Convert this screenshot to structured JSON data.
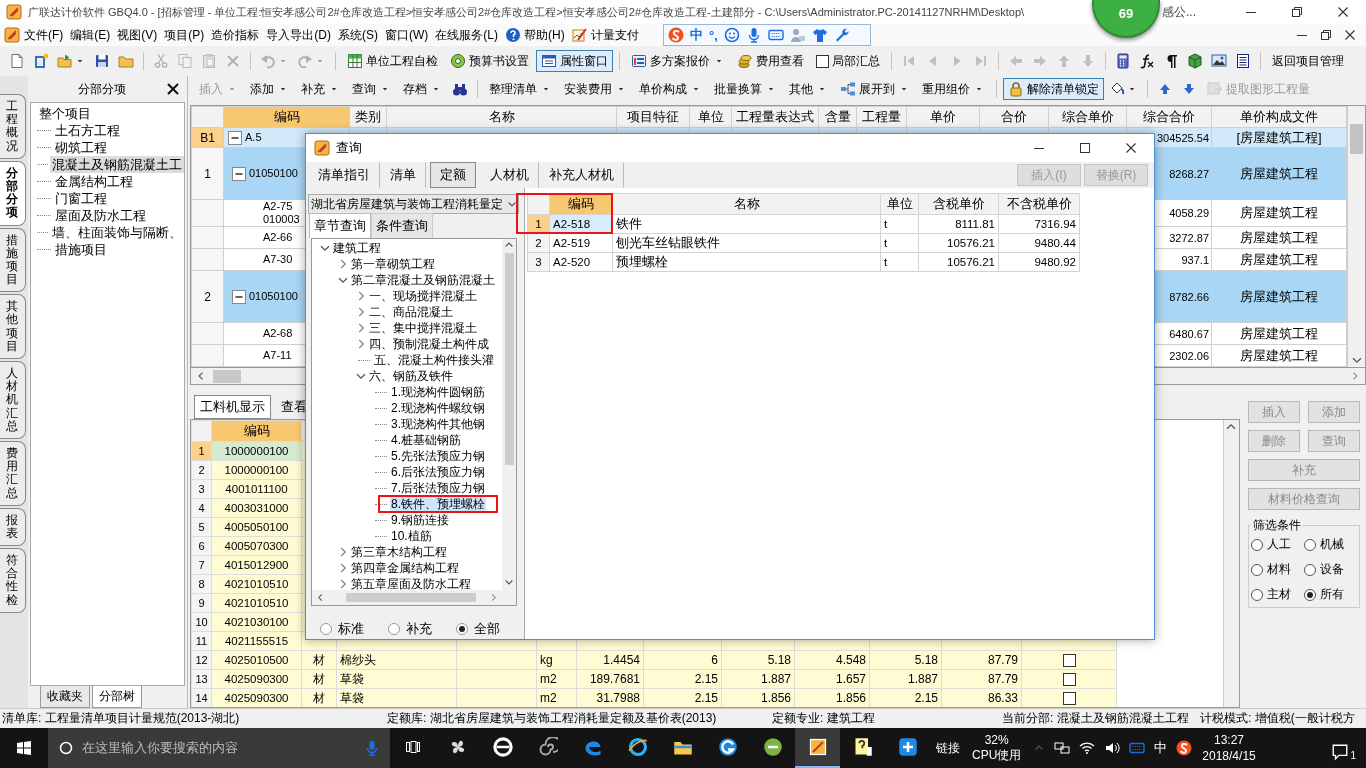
{
  "title_bar": {
    "title": "广联达计价软件 GBQ4.0 - [招标管理 - 单位工程:恒安孝感公司2#仓库改造工程>恒安孝感公司2#仓库改造工程>恒安孝感公司2#仓库改造工程-土建部分 - C:\\Users\\Administrator.PC-20141127NRHM\\Desktop\\",
    "badge": "69",
    "title_tail": "感公..."
  },
  "menu": [
    "文件(F)",
    "编辑(E)",
    "视图(V)",
    "项目(P)",
    "造价指标",
    "导入导出(D)",
    "系统(S)",
    "窗口(W)",
    "在线服务(L)",
    "帮助(H)",
    "计量支付"
  ],
  "ime_bar": {
    "labels": [
      "中",
      "°,"
    ]
  },
  "toolbar": [
    {
      "kind": "icon",
      "disabled": false,
      "pressed": false,
      "dropdown": false
    },
    {
      "kind": "icon",
      "disabled": false,
      "pressed": false,
      "dropdown": false
    },
    {
      "kind": "icon",
      "disabled": false,
      "pressed": false,
      "dropdown": true
    },
    {
      "kind": "icon",
      "disabled": false,
      "pressed": false,
      "dropdown": false
    },
    {
      "kind": "icon",
      "disabled": false,
      "pressed": false,
      "dropdown": false
    },
    {
      "kind": "sep"
    },
    {
      "kind": "icon",
      "disabled": true,
      "pressed": false,
      "dropdown": false
    },
    {
      "kind": "icon",
      "disabled": true,
      "pressed": false,
      "dropdown": false
    },
    {
      "kind": "icon",
      "disabled": true,
      "pressed": false,
      "dropdown": false
    },
    {
      "kind": "icon",
      "disabled": true,
      "pressed": false,
      "dropdown": false
    },
    {
      "kind": "sep"
    },
    {
      "kind": "icon",
      "disabled": true,
      "pressed": false,
      "dropdown": true
    },
    {
      "kind": "icon",
      "disabled": true,
      "pressed": false,
      "dropdown": true
    },
    {
      "kind": "sep"
    },
    {
      "kind": "button",
      "label": "单位工程自检",
      "disabled": false,
      "pressed": false,
      "dropdown": false
    },
    {
      "kind": "button",
      "label": "预算书设置",
      "disabled": false,
      "pressed": false,
      "dropdown": false
    },
    {
      "kind": "button",
      "label": "属性窗口",
      "disabled": false,
      "pressed": true,
      "dropdown": false
    },
    {
      "kind": "sep"
    },
    {
      "kind": "button",
      "label": "多方案报价",
      "disabled": false,
      "pressed": false,
      "dropdown": true
    },
    {
      "kind": "button",
      "label": "费用查看",
      "disabled": false,
      "pressed": false,
      "dropdown": false
    },
    {
      "kind": "check",
      "label": "局部汇总",
      "checked": false
    },
    {
      "kind": "sep"
    },
    {
      "kind": "icon",
      "disabled": true,
      "pressed": false,
      "dropdown": false
    },
    {
      "kind": "icon",
      "disabled": true,
      "pressed": false,
      "dropdown": false
    },
    {
      "kind": "icon",
      "disabled": true,
      "pressed": false,
      "dropdown": false
    },
    {
      "kind": "icon",
      "disabled": true,
      "pressed": false,
      "dropdown": false
    },
    {
      "kind": "sep"
    },
    {
      "kind": "icon",
      "disabled": true,
      "pressed": false,
      "dropdown": false
    },
    {
      "kind": "icon",
      "disabled": true,
      "pressed": false,
      "dropdown": false
    },
    {
      "kind": "icon",
      "disabled": true,
      "pressed": false,
      "dropdown": false
    },
    {
      "kind": "icon",
      "disabled": true,
      "pressed": false,
      "dropdown": false
    },
    {
      "kind": "sep"
    },
    {
      "kind": "icon",
      "disabled": false,
      "pressed": false,
      "dropdown": false
    },
    {
      "kind": "icon",
      "disabled": false,
      "pressed": false,
      "dropdown": false
    },
    {
      "kind": "icon",
      "disabled": false,
      "pressed": false,
      "dropdown": false
    },
    {
      "kind": "icon",
      "disabled": false,
      "pressed": false,
      "dropdown": false
    },
    {
      "kind": "icon",
      "disabled": false,
      "pressed": false,
      "dropdown": false
    },
    {
      "kind": "icon",
      "disabled": false,
      "pressed": false,
      "dropdown": false
    },
    {
      "kind": "sep"
    },
    {
      "kind": "button",
      "label": "返回项目管理",
      "disabled": false,
      "pressed": false,
      "dropdown": false
    }
  ],
  "side_tabs": [
    {
      "label": "工程概况",
      "selected": false
    },
    {
      "label": "分部分项",
      "selected": true
    },
    {
      "label": "措施项目",
      "selected": false
    },
    {
      "label": "其他项目",
      "selected": false
    },
    {
      "label": "人材机汇总",
      "selected": false
    },
    {
      "label": "费用汇总",
      "selected": false
    },
    {
      "label": "报表",
      "selected": false
    },
    {
      "label": "符合性检",
      "selected": false
    }
  ],
  "left_panel": {
    "title": "分部分项",
    "tree": [
      {
        "label": "整个项目",
        "selected": false,
        "children": [
          {
            "label": "土石方工程",
            "selected": false
          },
          {
            "label": "砌筑工程",
            "selected": false
          },
          {
            "label": "混凝土及钢筋混凝土工",
            "selected": true
          },
          {
            "label": "金属结构工程",
            "selected": false
          },
          {
            "label": "门窗工程",
            "selected": false
          },
          {
            "label": "屋面及防水工程",
            "selected": false
          },
          {
            "label": "墙、柱面装饰与隔断、",
            "selected": false
          },
          {
            "label": "措施项目",
            "selected": false
          }
        ]
      }
    ],
    "tabs": [
      {
        "label": "收藏夹",
        "selected": false
      },
      {
        "label": "分部树",
        "selected": true
      }
    ]
  },
  "toolbar2": [
    {
      "kind": "button",
      "label": "插入",
      "disabled": true,
      "pressed": false,
      "dropdown": true
    },
    {
      "kind": "button",
      "label": "添加",
      "disabled": false,
      "pressed": false,
      "dropdown": true
    },
    {
      "kind": "button",
      "label": "补充",
      "disabled": false,
      "pressed": false,
      "dropdown": true
    },
    {
      "kind": "button",
      "label": "查询",
      "disabled": false,
      "pressed": false,
      "dropdown": true
    },
    {
      "kind": "button",
      "label": "存档",
      "disabled": false,
      "pressed": false,
      "dropdown": true
    },
    {
      "kind": "icon",
      "disabled": false,
      "pressed": false,
      "dropdown": false
    },
    {
      "kind": "sep"
    },
    {
      "kind": "button",
      "label": "整理清单",
      "disabled": false,
      "pressed": false,
      "dropdown": true
    },
    {
      "kind": "button",
      "label": "安装费用",
      "disabled": false,
      "pressed": false,
      "dropdown": true
    },
    {
      "kind": "button",
      "label": "单价构成",
      "disabled": false,
      "pressed": false,
      "dropdown": true
    },
    {
      "kind": "button",
      "label": "批量换算",
      "disabled": false,
      "pressed": false,
      "dropdown": true
    },
    {
      "kind": "button",
      "label": "其他",
      "disabled": false,
      "pressed": false,
      "dropdown": true
    },
    {
      "kind": "button",
      "label": "展开到",
      "disabled": false,
      "pressed": false,
      "dropdown": true
    },
    {
      "kind": "button",
      "label": "重用组价",
      "disabled": false,
      "pressed": false,
      "dropdown": true
    },
    {
      "kind": "sep"
    },
    {
      "kind": "button",
      "label": "解除清单锁定",
      "disabled": false,
      "pressed": true,
      "dropdown": false
    },
    {
      "kind": "icon",
      "disabled": false,
      "pressed": false,
      "dropdown": true
    },
    {
      "kind": "sep"
    },
    {
      "kind": "icon",
      "disabled": false,
      "pressed": false,
      "dropdown": false
    },
    {
      "kind": "icon",
      "disabled": false,
      "pressed": false,
      "dropdown": false
    },
    {
      "kind": "button",
      "label": "提取图形工程量",
      "disabled": true,
      "pressed": false,
      "dropdown": false
    }
  ],
  "main_grid": {
    "columns": [
      {
        "label": "编码",
        "selected": true
      },
      {
        "label": "类别",
        "selected": false
      },
      {
        "label": "名称",
        "selected": false
      },
      {
        "label": "项目特征",
        "selected": false
      },
      {
        "label": "单位",
        "selected": false
      },
      {
        "label": "工程量表达式",
        "selected": false
      },
      {
        "label": "含量",
        "selected": false
      },
      {
        "label": "工程量",
        "selected": false
      },
      {
        "label": "单价",
        "selected": false
      },
      {
        "label": "合价",
        "selected": false
      },
      {
        "label": "综合单价",
        "selected": false
      },
      {
        "label": "综合合价",
        "selected": false
      },
      {
        "label": "单价构成文件",
        "selected": false
      }
    ],
    "rows": [
      {
        "kind": "section",
        "num": "B1",
        "code": "A.5",
        "total": "304525.54",
        "file": "[房屋建筑工程]",
        "selected": true
      },
      {
        "kind": "item",
        "num": "1",
        "code": "01050100",
        "total": "8268.27",
        "file": "房屋建筑工程",
        "selected": false
      },
      {
        "kind": "sub",
        "code": "A2-75\n010003",
        "total": "4058.29",
        "file": "房屋建筑工程",
        "selected": false
      },
      {
        "kind": "sub",
        "code": "A2-66",
        "total": "3272.87",
        "file": "房屋建筑工程",
        "selected": false
      },
      {
        "kind": "sub",
        "code": "A7-30",
        "total": "937.1",
        "file": "房屋建筑工程",
        "selected": false
      },
      {
        "kind": "item",
        "num": "2",
        "code": "01050100",
        "total": "8782.66",
        "file": "房屋建筑工程",
        "selected": false
      },
      {
        "kind": "sub",
        "code": "A2-68",
        "total": "6480.67",
        "file": "房屋建筑工程",
        "selected": false
      },
      {
        "kind": "sub",
        "code": "A7-11",
        "total": "2302.06",
        "file": "房屋建筑工程",
        "selected": false
      }
    ]
  },
  "bottom": {
    "tabs": [
      {
        "label": "工料机显示",
        "selected": true
      },
      {
        "label": "查看",
        "selected": false
      }
    ],
    "grid": {
      "columns": [
        {
          "label": "编码",
          "selected": true
        }
      ],
      "rows": [
        {
          "num": "1",
          "code": "1000000100",
          "selected": true
        },
        {
          "num": "2",
          "code": "1000000100",
          "selected": false
        },
        {
          "num": "3",
          "code": "4001011100",
          "selected": false
        },
        {
          "num": "4",
          "code": "4003031000",
          "selected": false
        },
        {
          "num": "5",
          "code": "4005050100",
          "selected": false
        },
        {
          "num": "6",
          "code": "4005070300",
          "selected": false
        },
        {
          "num": "7",
          "code": "4015012900",
          "selected": false
        },
        {
          "num": "8",
          "code": "4021010510",
          "selected": false
        },
        {
          "num": "9",
          "code": "4021010510",
          "selected": false
        },
        {
          "num": "10",
          "code": "4021030100",
          "selected": false
        },
        {
          "num": "11",
          "code": "4021155515",
          "selected": false
        },
        {
          "num": "12",
          "code": "4025010500",
          "selected": false,
          "column_3": "材",
          "column_4": "棉纱头",
          "column_6": "kg",
          "column_7": "1.4454",
          "column_8": "6",
          "column_9": "5.18",
          "column_10": "4.548",
          "column_11": "5.18",
          "column_12": "87.79",
          "checked": false
        },
        {
          "num": "13",
          "code": "4025090300",
          "selected": false,
          "column_3": "材",
          "column_4": "草袋",
          "column_6": "m2",
          "column_7": "189.7681",
          "column_8": "2.15",
          "column_9": "1.887",
          "column_10": "1.657",
          "column_11": "1.887",
          "column_12": "87.79",
          "checked": false
        },
        {
          "num": "14",
          "code": "4025090300",
          "selected": false,
          "column_3": "材",
          "column_4": "草袋",
          "column_6": "m2",
          "column_7": "31.7988",
          "column_8": "2.15",
          "column_9": "1.856",
          "column_10": "1.856",
          "column_11": "2.15",
          "column_12": "86.33",
          "checked": false
        }
      ]
    },
    "buttons": [
      {
        "label": "插入",
        "disabled": true
      },
      {
        "label": "添加",
        "disabled": true
      },
      {
        "label": "删除",
        "disabled": true
      },
      {
        "label": "查询",
        "disabled": true
      },
      {
        "label": "补充",
        "disabled": true
      },
      {
        "label": "材料价格查询",
        "disabled": true
      }
    ],
    "filter": {
      "title": "筛选条件",
      "options": [
        {
          "label": "人工",
          "selected": false
        },
        {
          "label": "机械",
          "selected": false
        },
        {
          "label": "材料",
          "selected": false
        },
        {
          "label": "设备",
          "selected": false
        },
        {
          "label": "主材",
          "selected": false
        },
        {
          "label": "所有",
          "selected": true
        }
      ]
    }
  },
  "dialog": {
    "title": "查询",
    "tabs": [
      {
        "label": "清单指引",
        "selected": false
      },
      {
        "label": "清单",
        "selected": false
      },
      {
        "label": "定额",
        "selected": true
      },
      {
        "label": "人材机",
        "selected": false
      },
      {
        "label": "补充人材机",
        "selected": false
      }
    ],
    "actions": [
      {
        "label": "插入(I)",
        "disabled": true
      },
      {
        "label": "替换(R)",
        "disabled": true
      }
    ],
    "library": "湖北省房屋建筑与装饰工程消耗量定",
    "search_tabs": [
      {
        "label": "章节查询",
        "selected": true
      },
      {
        "label": "条件查询",
        "selected": false
      }
    ],
    "tree": [
      {
        "label": "建筑工程",
        "expanded": true,
        "selected": false,
        "children": [
          {
            "label": "第一章砌筑工程",
            "expanded": false,
            "selected": false
          },
          {
            "label": "第二章混凝土及钢筋混凝土",
            "expanded": true,
            "selected": false,
            "children": [
              {
                "label": "一、现场搅拌混凝土",
                "expanded": false,
                "selected": false
              },
              {
                "label": "二、商品混凝土",
                "expanded": false,
                "selected": false
              },
              {
                "label": "三、集中搅拌混凝土",
                "expanded": false,
                "selected": false
              },
              {
                "label": "四、预制混凝土构件成",
                "expanded": false,
                "selected": false
              },
              {
                "label": "五、混凝土构件接头灌",
                "selected": false
              },
              {
                "label": "六、钢筋及铁件",
                "expanded": true,
                "selected": false,
                "children": [
                  {
                    "label": "1.现浇构件圆钢筋",
                    "selected": false
                  },
                  {
                    "label": "2.现浇构件螺纹钢",
                    "selected": false
                  },
                  {
                    "label": "3.现浇构件其他钢",
                    "selected": false
                  },
                  {
                    "label": "4.桩基础钢筋",
                    "selected": false
                  },
                  {
                    "label": "5.先张法预应力钢",
                    "selected": false
                  },
                  {
                    "label": "6.后张法预应力钢",
                    "selected": false
                  },
                  {
                    "label": "7.后张法预应力钢",
                    "selected": false
                  },
                  {
                    "label": "8.铁件、预埋螺栓",
                    "selected": true
                  },
                  {
                    "label": "9.钢筋连接",
                    "selected": false
                  },
                  {
                    "label": "10.植筋",
                    "selected": false
                  }
                ]
              }
            ]
          },
          {
            "label": "第三章木结构工程",
            "expanded": false,
            "selected": false
          },
          {
            "label": "第四章金属结构工程",
            "expanded": false,
            "selected": false
          },
          {
            "label": "第五章屋面及防水工程",
            "expanded": false,
            "selected": false
          }
        ]
      }
    ],
    "scope": [
      {
        "label": "标准",
        "selected": false
      },
      {
        "label": "补充",
        "selected": false
      },
      {
        "label": "全部",
        "selected": true
      }
    ],
    "table": {
      "columns": [
        {
          "label": "编码",
          "selected": true
        },
        {
          "label": "名称",
          "selected": false
        },
        {
          "label": "单位",
          "selected": false
        },
        {
          "label": "含税单价",
          "selected": false
        },
        {
          "label": "不含税单价",
          "selected": false
        }
      ],
      "rows": [
        {
          "num": "1",
          "code": "A2-518",
          "name": "铁件",
          "unit": "t",
          "tax_price": "8111.81",
          "price": "7316.94",
          "selected": true
        },
        {
          "num": "2",
          "code": "A2-519",
          "name": "刨光车丝钻眼铁件",
          "unit": "t",
          "tax_price": "10576.21",
          "price": "9480.44",
          "selected": false
        },
        {
          "num": "3",
          "code": "A2-520",
          "name": "预埋螺栓",
          "unit": "t",
          "tax_price": "10576.21",
          "price": "9480.92",
          "selected": false
        }
      ]
    }
  },
  "status_bar": [
    "清单库: 工程量清单项目计量规范(2013-湖北)",
    "定额库: 湖北省房屋建筑与装饰工程消耗量定额及基价表(2013)",
    "定额专业: 建筑工程",
    "当前分部: 混凝土及钢筋混凝土工程",
    "计税模式: 增值税(一般计税方"
  ],
  "taskbar": {
    "search_placeholder": "在这里输入你要搜索的内容",
    "link": "链接",
    "cpu": "32%",
    "cpu_label": "CPU使用",
    "ime": "中",
    "time": "13:27",
    "date": "2018/4/15",
    "notifications": "1"
  }
}
